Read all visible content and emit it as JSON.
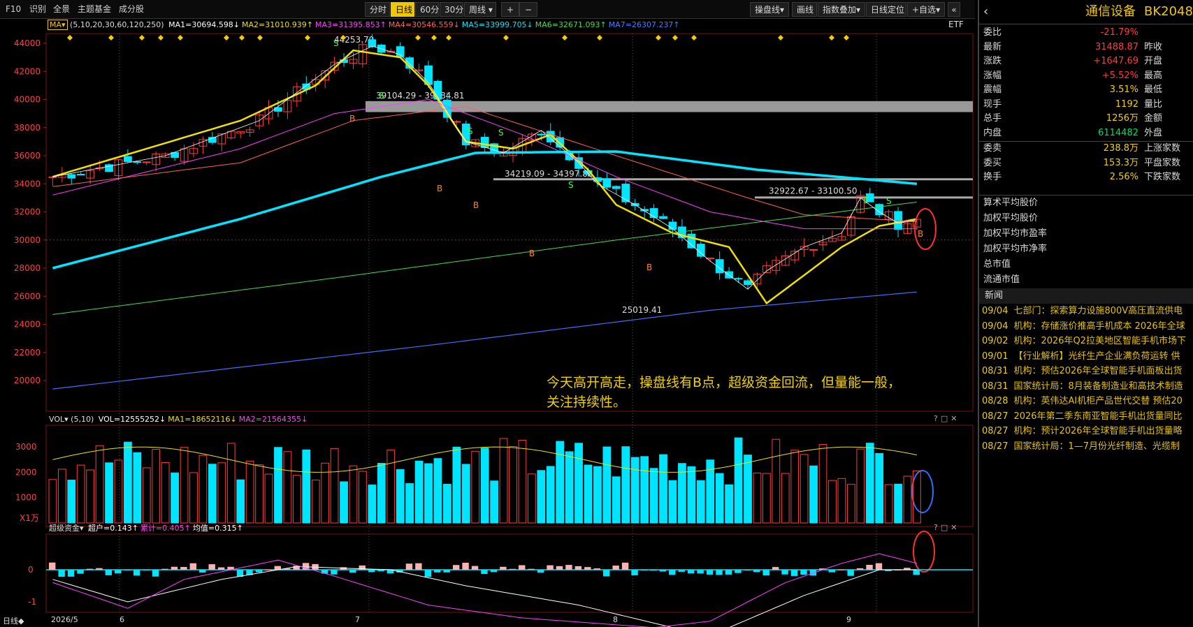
{
  "toolbar": {
    "left_tabs": [
      "F10",
      "识别",
      "全景",
      "主题基金",
      "成分股"
    ],
    "periods": [
      "分时",
      "日线",
      "60分",
      "30分",
      "周线"
    ],
    "active_period": "日线",
    "right_buttons": [
      "操盘线",
      "画线",
      "指数叠加",
      "日线定位",
      "+自选"
    ]
  },
  "main_chart": {
    "indicator_label": "MA",
    "params": "(5,10,20,30,60,120,250)",
    "ma_values": [
      {
        "label": "MA1=30694.598↓",
        "color": "#ffffff"
      },
      {
        "label": "MA2=31010.939↑",
        "color": "#f0e000"
      },
      {
        "label": "MA3=31395.853↑",
        "color": "#ff40ff"
      },
      {
        "label": "MA4=30546.559↓",
        "color": "#ff6060"
      },
      {
        "label": "MA5=33999.705↓",
        "color": "#00e5ff"
      },
      {
        "label": "MA6=32671.093↑",
        "color": "#40e040"
      },
      {
        "label": "MA7=26307.237↑",
        "color": "#4080ff"
      }
    ],
    "etf_label": "ETF",
    "price_ticks": [
      "44000",
      "42000",
      "40000",
      "38000",
      "36000",
      "34000",
      "32000",
      "30000",
      "28000",
      "26000",
      "24000",
      "22000",
      "20000"
    ],
    "annotations": {
      "high": "44253.70",
      "low": "25019.41",
      "zone1": "39104.29 - 39884.81",
      "zone2": "34219.09 - 34397.88",
      "zone3": "32922.67 - 33100.50"
    },
    "comment_line1": "今天高开高走，操盘线有B点，超级资金回流，但量能一般，",
    "comment_line2": "关注持续性。"
  },
  "volume_chart": {
    "label": "VOL",
    "params": "(5,10)",
    "values": [
      {
        "label": "VOL=12555252↓",
        "color": "#ffffff"
      },
      {
        "label": "MA1=18652116↓",
        "color": "#f0e000"
      },
      {
        "label": "MA2=21564355↓",
        "color": "#ff40ff"
      }
    ],
    "ticks": [
      "3000",
      "2000",
      "1000"
    ],
    "unit": "X1万"
  },
  "fund_chart": {
    "label": "超级资金",
    "values": [
      {
        "label": "超户=0.143↑",
        "color": "#ffffff"
      },
      {
        "label": "累计=0.405↑",
        "color": "#ff40ff"
      },
      {
        "label": "均值=0.315↑",
        "color": "#ffffff"
      }
    ],
    "ticks": [
      "0",
      "-1"
    ]
  },
  "date_axis": {
    "period_label": "日线◆",
    "labels": [
      "2026/5",
      "6",
      "7",
      "8",
      "9"
    ]
  },
  "panel_icons": [
    "?",
    "□",
    "✕"
  ],
  "right_panel": {
    "name": "通信设备",
    "code": "BK2048",
    "quotes": [
      {
        "label": "委比",
        "value": "-21.79%",
        "label2": "",
        "color": "red"
      },
      {
        "label": "最新",
        "value": "31488.87",
        "label2": "昨收",
        "color": "red"
      },
      {
        "label": "涨跌",
        "value": "+1647.69",
        "label2": "开盘",
        "color": "red"
      },
      {
        "label": "涨幅",
        "value": "+5.52%",
        "label2": "最高",
        "color": "red"
      },
      {
        "label": "震幅",
        "value": "3.51%",
        "label2": "最低",
        "color": "yellow"
      },
      {
        "label": "现手",
        "value": "1192",
        "label2": "量比",
        "color": "yellow"
      },
      {
        "label": "总手",
        "value": "1256万",
        "label2": "金额",
        "color": "yellow"
      },
      {
        "label": "内盘",
        "value": "6114482",
        "label2": "外盘",
        "color": "green"
      },
      {
        "label": "委卖",
        "value": "238.8万",
        "label2": "上涨家数",
        "color": "yellow"
      },
      {
        "label": "委买",
        "value": "153.3万",
        "label2": "平盘家数",
        "color": "yellow"
      },
      {
        "label": "换手",
        "value": "2.56%",
        "label2": "下跌家数",
        "color": "yellow"
      }
    ],
    "metrics": [
      "算术平均股价",
      "加权平均股价",
      "加权平均市盈率",
      "加权平均市净率",
      "总市值",
      "流通市值"
    ],
    "news_title": "新闻",
    "news": [
      {
        "date": "09/04",
        "text": "七部门：探索算力设施800V高压直流供电"
      },
      {
        "date": "09/04",
        "text": "机构：存储涨价推高手机成本 2026年全球"
      },
      {
        "date": "09/02",
        "text": "机构：2026年Q2拉美地区智能手机市场下"
      },
      {
        "date": "09/01",
        "text": "【行业解析】光纤生产企业满负荷运转 供"
      },
      {
        "date": "08/31",
        "text": "机构：预估2026年全球智能手机面板出货"
      },
      {
        "date": "08/31",
        "text": "国家统计局：8月装备制造业和高技术制造"
      },
      {
        "date": "08/28",
        "text": "机构：英伟达AI机柜产品世代交替 预估20"
      },
      {
        "date": "08/27",
        "text": "2026年第二季东南亚智能手机出货量同比"
      },
      {
        "date": "08/27",
        "text": "机构：预计2026年全球智能手机出货量略"
      },
      {
        "date": "08/27",
        "text": "国家统计局：1—7月份光纤制造、光缆制"
      }
    ]
  }
}
